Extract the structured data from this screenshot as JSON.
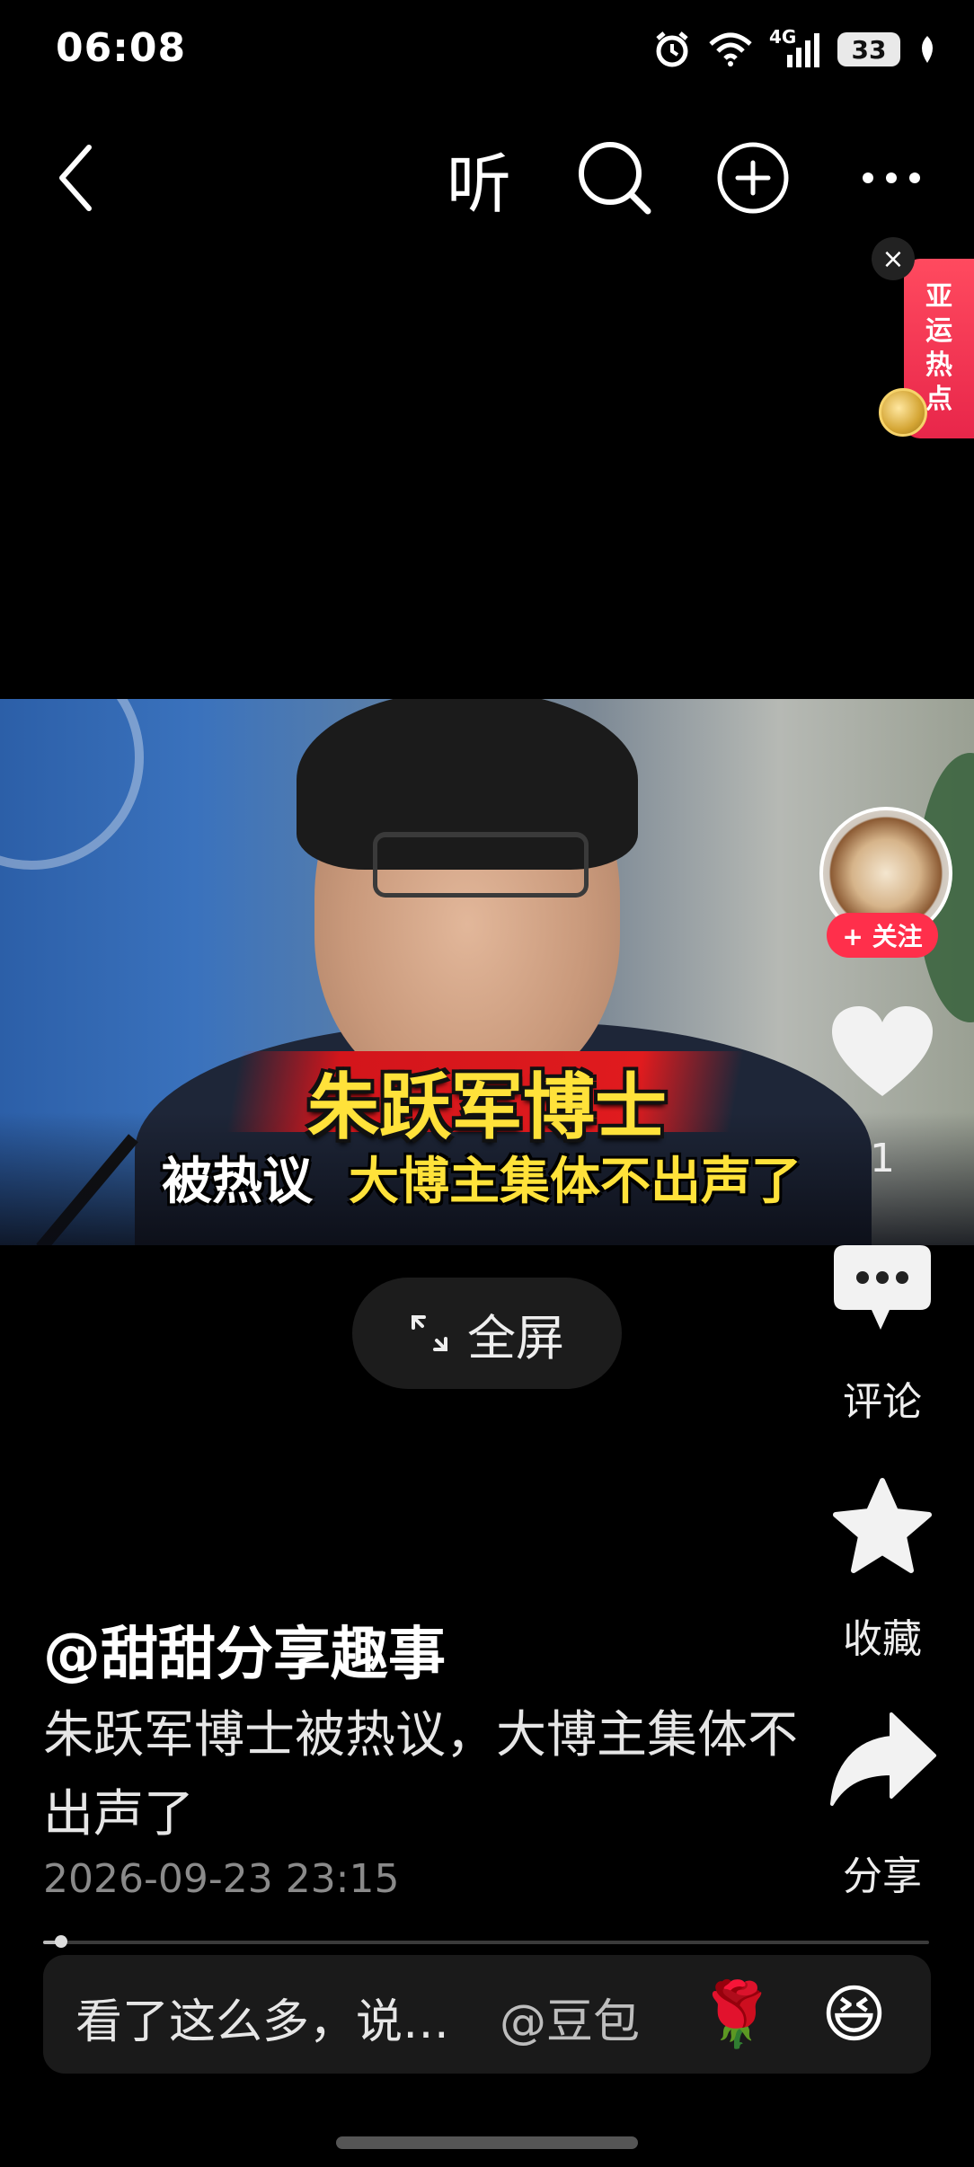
{
  "status_bar": {
    "time": "06:08",
    "network": "4G",
    "battery": "33",
    "icons": [
      "alarm-icon",
      "wifi-icon",
      "signal-icon",
      "battery-icon",
      "leaf-icon"
    ]
  },
  "top_nav": {
    "back_icon": "chevron-left-icon",
    "listen_label": "听",
    "search_icon": "search-icon",
    "add_icon": "plus-circle-icon",
    "more_icon": "more-dots-icon"
  },
  "floating_badge": {
    "close_glyph": "×",
    "lines": [
      "亚",
      "运",
      "热",
      "点"
    ]
  },
  "video": {
    "headline_main": "朱跃军博士",
    "headline_sub_white": "被热议",
    "headline_sub_yellow": "大博主集体不出声了"
  },
  "fullscreen": {
    "label": "全屏"
  },
  "actions": {
    "follow_label": "+ 关注",
    "like_count": "1",
    "comment_label": "评论",
    "favorite_label": "收藏",
    "share_label": "分享"
  },
  "post": {
    "author": "@甜甜分享趣事",
    "caption": "朱跃军博士被热议，大博主集体不出声了",
    "timestamp": "2026-09-23 23:15",
    "progress": 0.02
  },
  "comment_bar": {
    "placeholder": "看了这么多，说…",
    "mention": "@豆包",
    "emoji_rose": "🌹",
    "emoji_laugh": "😆"
  },
  "colors": {
    "background": "#000000",
    "accent_red": "#ff2f4b",
    "headline_yellow": "#ffe23a"
  }
}
